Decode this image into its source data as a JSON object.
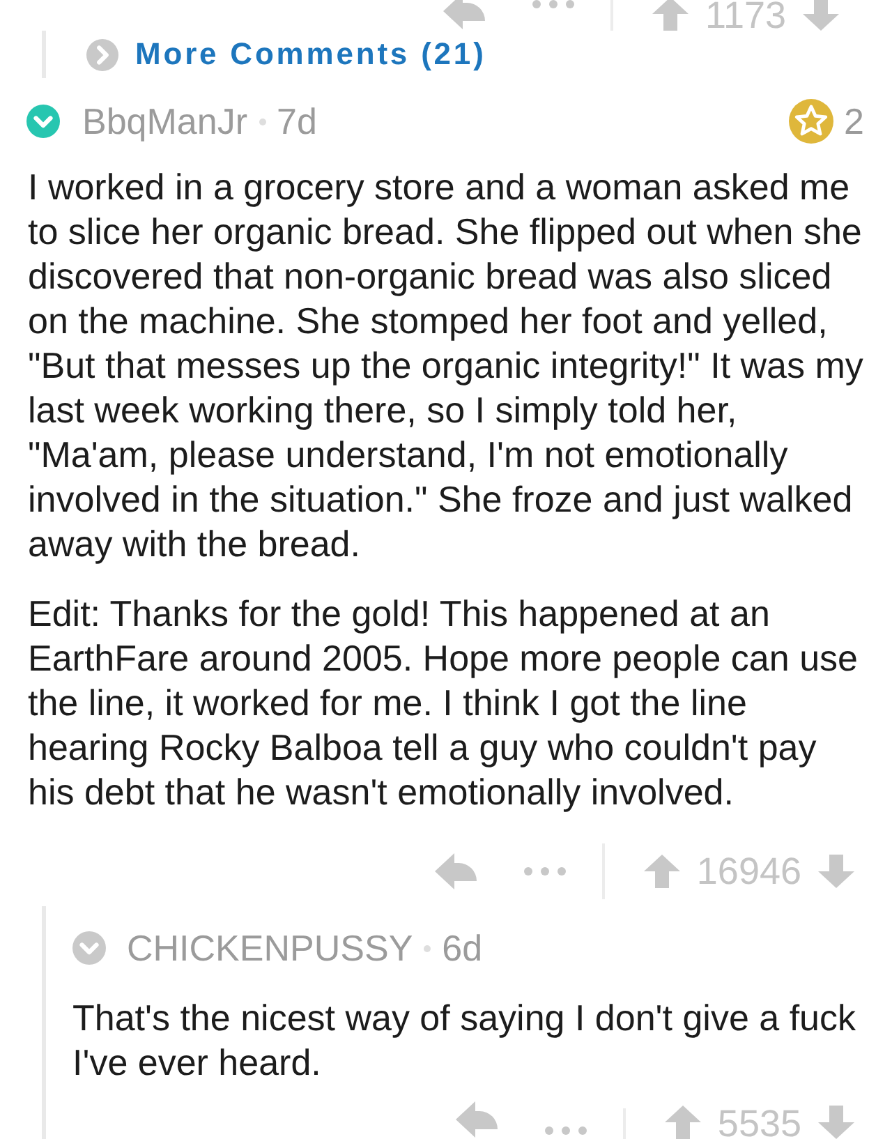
{
  "previous_reply_actions": {
    "score": "1173"
  },
  "more_comments": {
    "label": "More Comments (21)"
  },
  "comment": {
    "author": "BbqManJr",
    "highlighted": true,
    "age": "7d",
    "gold_count": "2",
    "paragraphs": [
      "I worked in a grocery store and a woman asked me to slice her organic bread. She flipped out when she discovered that non-organic bread was also sliced on the machine. She stomped her foot and yelled, \"But that messes up the organic integrity!\" It was my last week working there, so I simply told her, \"Ma'am, please understand, I'm not emotionally involved in the situation.\" She froze and just walked away with the bread.",
      "Edit: Thanks for the gold! This happened at an EarthFare around 2005. Hope more people can use the line, it worked for me. I think I got the line hearing Rocky Balboa tell a guy who couldn't pay his debt that he wasn't emotionally involved."
    ],
    "score": "16946",
    "replies": [
      {
        "author": "CHICKENPUSSY",
        "highlighted": false,
        "age": "6d",
        "paragraphs": [
          "That's the nicest way of saying I don't give a fuck I've ever heard."
        ],
        "score": "5535"
      }
    ]
  }
}
